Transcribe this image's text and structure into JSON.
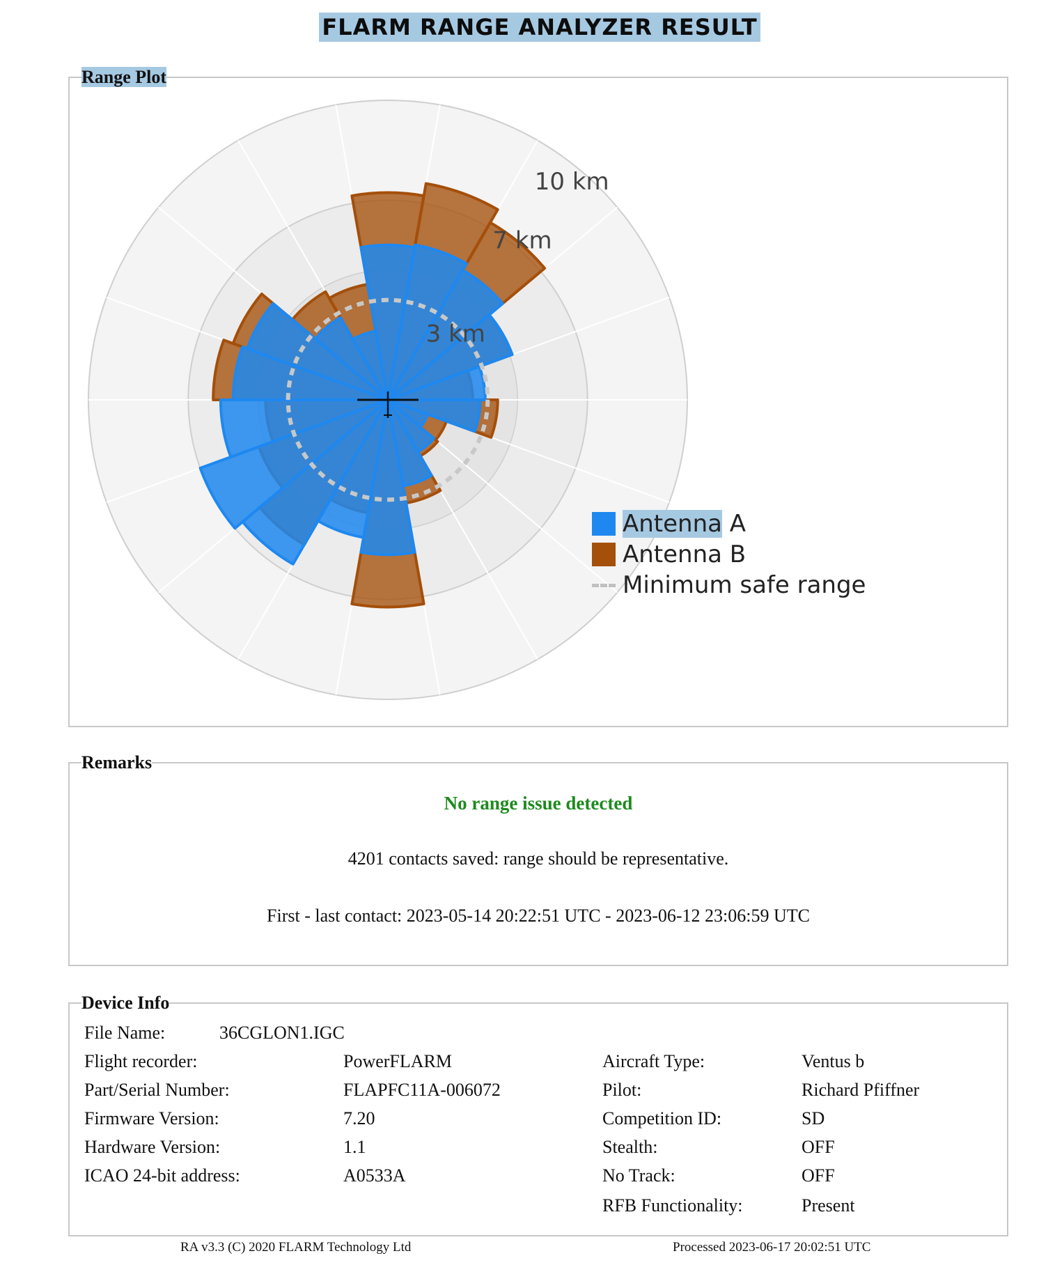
{
  "title": "FLARM RANGE ANALYZER RESULT",
  "range_plot": {
    "legend": "Range Plot"
  },
  "chart_data": {
    "type": "polar-bar",
    "ring_labels": [
      "3 km",
      "7 km",
      "10 km"
    ],
    "rlim": [
      0,
      12
    ],
    "sector_count": 18,
    "minimum_safe_range_km": 4,
    "colors": {
      "antenna_a": "#1e88f0",
      "antenna_b": "#a44f0a",
      "minimum_safe_range": "#c8c8c8"
    },
    "series": [
      {
        "name": "Antenna A",
        "values": [
          6.2,
          6.3,
          6.0,
          5.3,
          3.9,
          3.7,
          1.7,
          2.4,
          3.5,
          6.2,
          5.6,
          7.6,
          8.0,
          6.7,
          6.2,
          6.0,
          3.8,
          2.8
        ]
      },
      {
        "name": "Antenna B",
        "values": [
          8.3,
          8.8,
          8.2,
          5.3,
          3.4,
          4.4,
          2.5,
          2.6,
          4.2,
          8.3,
          4.6,
          6.7,
          5.5,
          4.9,
          7.0,
          6.6,
          5.0,
          4.7
        ]
      }
    ],
    "legend": [
      "Antenna A",
      "Antenna B",
      "Minimum safe range"
    ],
    "legend_position": "bottom-right"
  },
  "remarks": {
    "legend": "Remarks",
    "status": "No range issue detected",
    "contacts": "4201 contacts saved: range should be representative.",
    "period": "First - last contact: 2023-05-14 20:22:51 UTC - 2023-06-12 23:06:59 UTC"
  },
  "device_info": {
    "legend": "Device Info",
    "file_name_label": "File Name:",
    "file_name": "36CGLON1.IGC",
    "left": [
      {
        "label": "Flight recorder:",
        "value": "PowerFLARM"
      },
      {
        "label": "Part/Serial Number:",
        "value": "FLAPFC11A-006072"
      },
      {
        "label": "Firmware Version:",
        "value": "7.20"
      },
      {
        "label": "Hardware Version:",
        "value": "1.1"
      },
      {
        "label": "ICAO 24-bit address:",
        "value": "A0533A"
      }
    ],
    "right": [
      {
        "label": "Aircraft Type:",
        "value": "Ventus b"
      },
      {
        "label": "Pilot:",
        "value": "Richard Pfiffner"
      },
      {
        "label": "Competition ID:",
        "value": "SD"
      },
      {
        "label": "Stealth:",
        "value": "OFF"
      },
      {
        "label": "No Track:",
        "value": "OFF"
      },
      {
        "label": "RFB Functionality:",
        "value": "Present"
      }
    ]
  },
  "footer": {
    "version": "RA v3.3 (C) 2020 FLARM Technology Ltd",
    "processed": "Processed 2023-06-17 20:02:51 UTC"
  }
}
